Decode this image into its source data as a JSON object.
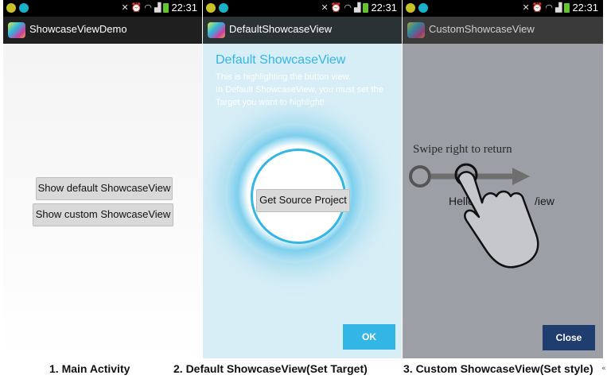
{
  "status_bar": {
    "time": "22:31"
  },
  "panels": [
    {
      "app_title": "ShowcaseViewDemo",
      "buttons": [
        "Show default ShowcaseView",
        "Show custom ShowcaseView"
      ],
      "caption": "1. Main Activity"
    },
    {
      "app_title": "DefaultShowcaseView",
      "showcase_title": "Default ShowcaseView",
      "showcase_lines": [
        "This is highlighting the button view.",
        "In Default ShowcaseView, you must set the",
        "Target you want to highlight!"
      ],
      "target_button": "Get Source Project",
      "ok_label": "OK",
      "caption": "2. Default ShowcaseView(Set Target)"
    },
    {
      "app_title": "CustomShowcaseView",
      "swipe_text": "Swipe right to return",
      "hello_start": "Hello",
      "hello_end": "/iew",
      "close_label": "Close",
      "caption": "3. Custom ShowcaseView(Set style)"
    }
  ],
  "corner_mark": "«",
  "colors": {
    "accent_blue": "#33b5e5",
    "close_button": "#1f3d6e",
    "custom_overlay": "#9d9fa6",
    "status_bar": "#000000",
    "action_bar": "#1f1f1f"
  },
  "icons": [
    "notification-icon",
    "sync-icon",
    "silent-icon",
    "alarm-icon",
    "wifi-icon",
    "signal-icon",
    "battery-icon",
    "app-launcher-icon",
    "gesture-hand-icon"
  ]
}
